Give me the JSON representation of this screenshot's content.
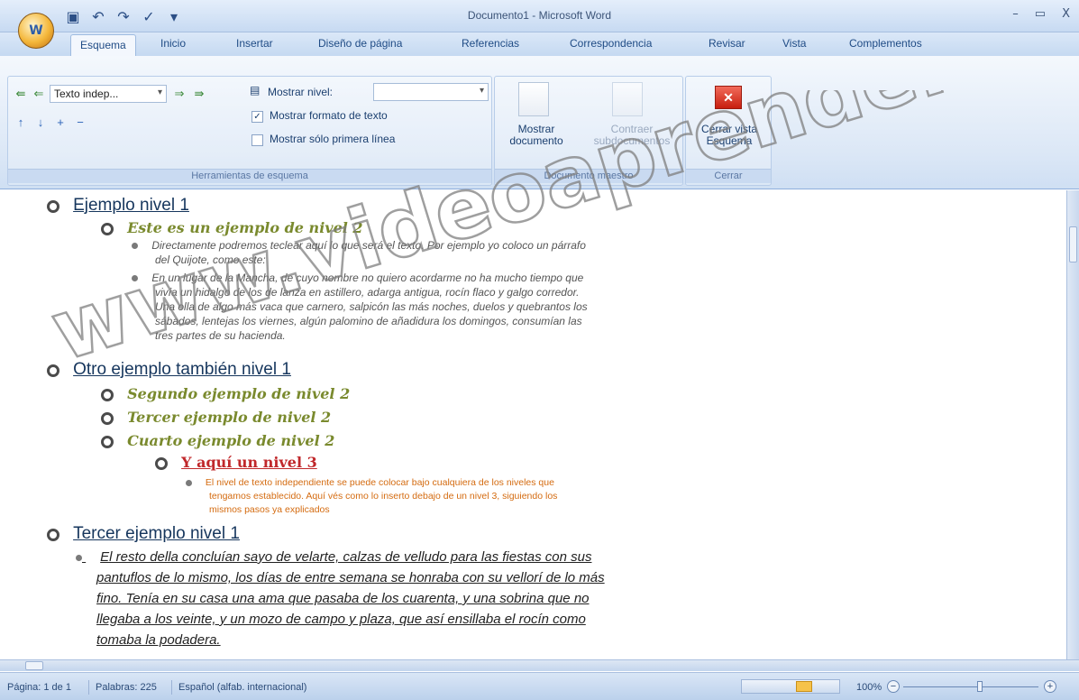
{
  "window": {
    "title": "Documento1 - Microsoft Word",
    "office_button": "W",
    "controls": [
      "–",
      "▭",
      "X"
    ]
  },
  "qat": {
    "icons": [
      "save-icon",
      "undo-icon",
      "redo-icon",
      "spellcheck-icon",
      "customize-icon"
    ],
    "glyphs": [
      "▣",
      "↶",
      "↷",
      "✓",
      "▾"
    ]
  },
  "tabs": [
    "Esquema",
    "Inicio",
    "Insertar",
    "Diseño de página",
    "Referencias",
    "Correspondencia",
    "Revisar",
    "Vista",
    "Complementos"
  ],
  "ribbon": {
    "outline_tools": {
      "level_select": "Texto indep...",
      "show_level_label": "Mostrar nivel:",
      "show_format_label": "Mostrar formato de texto",
      "show_first_line_label": "Mostrar sólo primera línea",
      "group_label": "Herramientas de esquema",
      "arrows": [
        "⇚",
        "⇐",
        "⇒",
        "⇛",
        "↑",
        "↓",
        "+",
        "−"
      ]
    },
    "master_document": {
      "show_label": "Mostrar documento",
      "collapse_label": "Contraer subdocumentos",
      "group_label": "Documento maestro"
    },
    "close": {
      "button_label": "Cerrar vista Esquema",
      "group_label": "Cerrar",
      "icon_glyph": "✕"
    }
  },
  "document": {
    "h1_1": "Ejemplo nivel 1",
    "h2_1": "Este es un ejemplo de nivel 2",
    "p1_l1": "Directamente podremos teclear aquí lo que será el texto. Por ejemplo yo coloco un párrafo",
    "p1_l2": "del Quijote, como este:",
    "p2_l1": "En un lugar de la Mancha, de cuyo nombre no quiero acordarme no ha mucho tiempo que",
    "p2_l2": "vivía un hidalgo de los de lanza en astillero, adarga antigua, rocín flaco y galgo corredor.",
    "p2_l3": "Una olla de algo más vaca que carnero, salpicón las más noches, duelos y quebrantos los",
    "p2_l4": "sábados, lentejas los viernes, algún palomino de añadidura los domingos, consumían las",
    "p2_l5": "tres partes de su hacienda.",
    "h1_2": "Otro ejemplo también nivel 1",
    "h2_2": "Segundo ejemplo de nivel 2",
    "h2_3": "Tercer ejemplo de nivel 2",
    "h2_4": "Cuarto ejemplo de nivel 2",
    "h3_1": "Y aquí un nivel 3",
    "p3_l1": "El nivel de texto independiente se puede colocar bajo cualquiera de los niveles que",
    "p3_l2": "tengamos establecido. Aquí vés como lo inserto debajo de un nivel 3, siguiendo los",
    "p3_l3": "mismos pasos ya explicados",
    "h1_3": "Tercer ejemplo nivel 1",
    "p4_l1": "El resto della concluían sayo de velarte, calzas de velludo para las fiestas con sus",
    "p4_l2": "pantuflos de lo mismo, los días de entre semana se honraba con su vellorí de lo más",
    "p4_l3": "fino. Tenía en su casa una ama que pasaba de los cuarenta, y una sobrina que no",
    "p4_l4": "llegaba a los veinte, y un mozo de campo y plaza, que así ensillaba el rocín como",
    "p4_l5": "tomaba la podadera."
  },
  "watermark": "www.videoaprender.com",
  "status": {
    "page": "Página: 1 de 1",
    "words": "Palabras: 225",
    "language": "Español (alfab. internacional)",
    "zoom": "100%"
  },
  "colors": {
    "accent": "#1f4b85",
    "h1": "#16365d",
    "h2": "#7a8a2e",
    "h3": "#c0282b",
    "body3": "#d46b10"
  }
}
